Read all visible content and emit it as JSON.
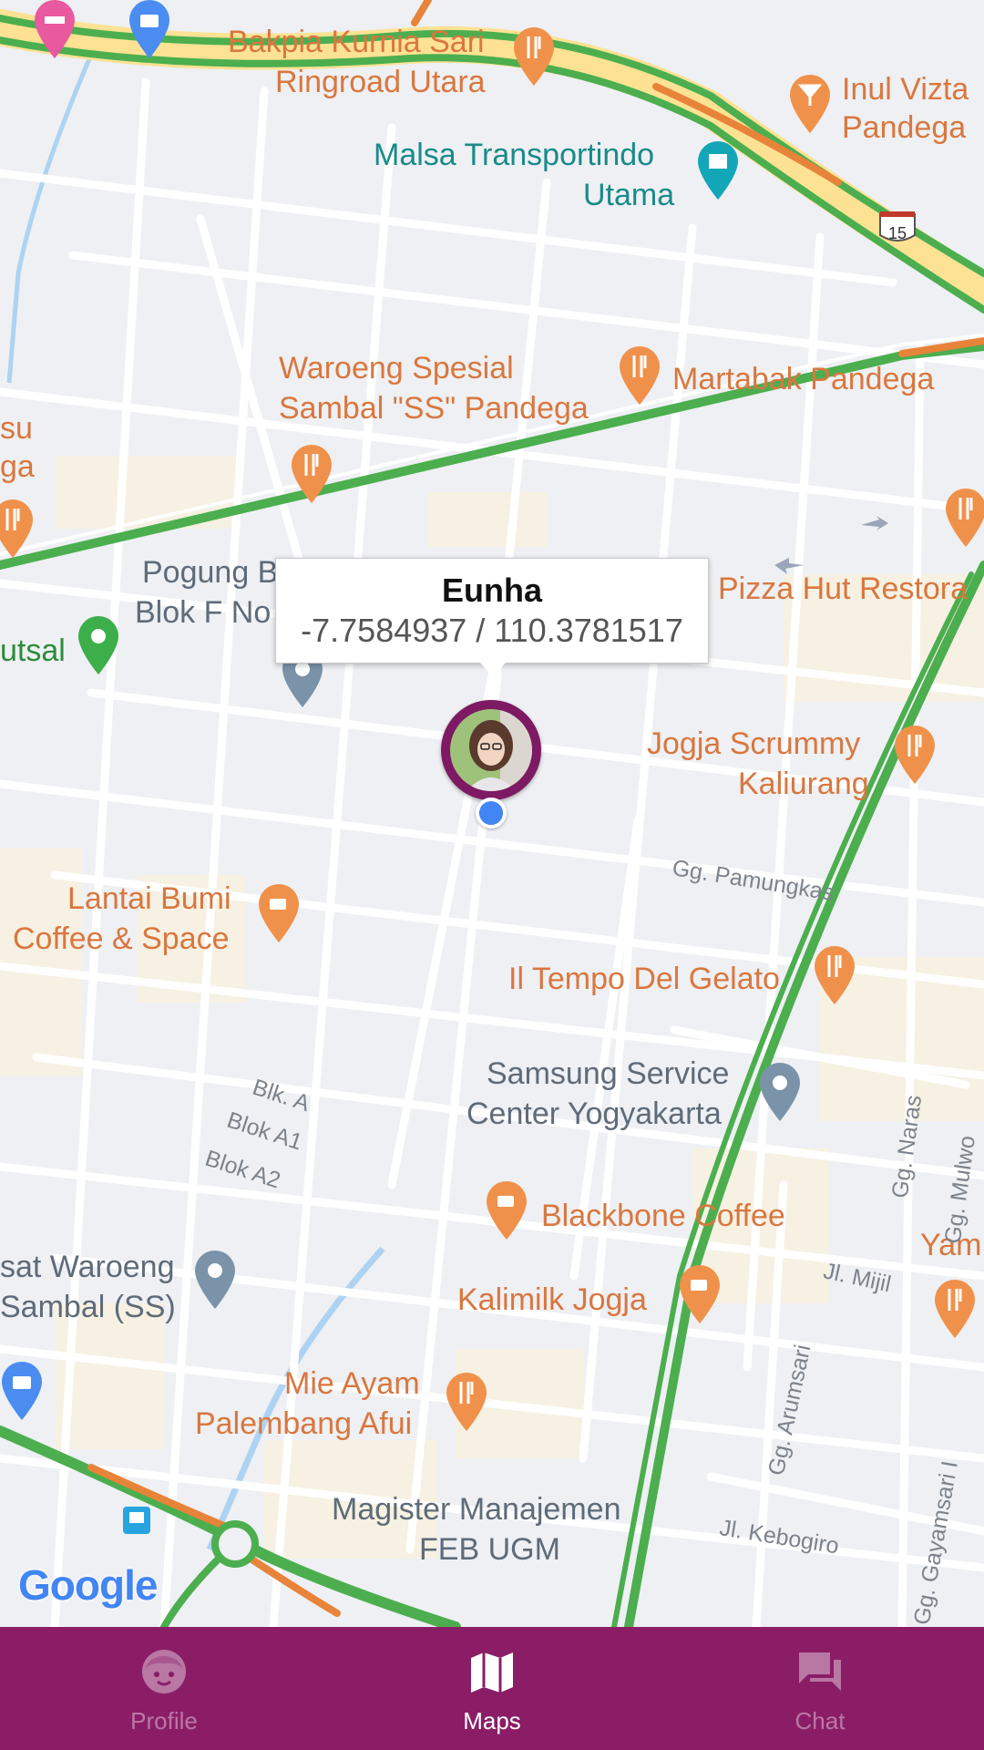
{
  "map": {
    "provider_logo": "Google",
    "poi_labels": [
      {
        "text": "Bakpia Kurnia Sari",
        "color": "orange"
      },
      {
        "text": "Ringroad Utara",
        "color": "orange"
      },
      {
        "text": "Inul Vizta",
        "color": "orange"
      },
      {
        "text": "Pandega",
        "color": "orange"
      },
      {
        "text": "Malsa Transportindo",
        "color": "teal"
      },
      {
        "text": "Utama",
        "color": "teal"
      },
      {
        "text": "Waroeng Spesial",
        "color": "orange"
      },
      {
        "text": "Sambal \"SS\" Pandega",
        "color": "orange"
      },
      {
        "text": "Martabak Pandega",
        "color": "orange"
      },
      {
        "text": "su",
        "color": "orange"
      },
      {
        "text": "ga",
        "color": "orange"
      },
      {
        "text": "Pogung B",
        "color": "gray"
      },
      {
        "text": "Blok F No",
        "color": "gray"
      },
      {
        "text": "utsal",
        "color": "green"
      },
      {
        "text": "Pizza Hut Restora",
        "color": "orange"
      },
      {
        "text": "Jogja Scrummy",
        "color": "orange"
      },
      {
        "text": "Kaliurang",
        "color": "orange"
      },
      {
        "text": "Lantai Bumi",
        "color": "orange"
      },
      {
        "text": "Coffee & Space",
        "color": "orange"
      },
      {
        "text": "Il Tempo Del Gelato",
        "color": "orange"
      },
      {
        "text": "Samsung Service",
        "color": "gray"
      },
      {
        "text": "Center Yogyakarta",
        "color": "gray"
      },
      {
        "text": "Blackbone Coffee",
        "color": "orange"
      },
      {
        "text": "Yam",
        "color": "orange"
      },
      {
        "text": "sat Waroeng",
        "color": "gray"
      },
      {
        "text": "Sambal (SS)",
        "color": "gray"
      },
      {
        "text": "Kalimilk Jogja",
        "color": "orange"
      },
      {
        "text": "Mie Ayam",
        "color": "orange"
      },
      {
        "text": "Palembang Afui",
        "color": "orange"
      },
      {
        "text": "Magister Manajemen",
        "color": "gray"
      },
      {
        "text": "FEB UGM",
        "color": "gray"
      }
    ],
    "street_labels": [
      "Gg. Pamungkas",
      "Blk. A",
      "Blok A1",
      "Blok A2",
      "Jl. Mijil",
      "Gg. Arumsari",
      "Gg. Naras",
      "Gg. Mulwo",
      "Jl. Kebogiro",
      "Gg. Gayamsari I"
    ],
    "route_shield": "15"
  },
  "marker": {
    "title": "Eunha",
    "coordinates": "-7.7584937 / 110.3781517"
  },
  "nav": {
    "items": [
      {
        "label": "Profile",
        "icon": "profile-face-icon",
        "active": false
      },
      {
        "label": "Maps",
        "icon": "map-icon",
        "active": true
      },
      {
        "label": "Chat",
        "icon": "chat-icon",
        "active": false
      }
    ],
    "colors": {
      "background": "#8b1d67",
      "active": "#ffffff",
      "inactive": "#c48db1"
    }
  }
}
